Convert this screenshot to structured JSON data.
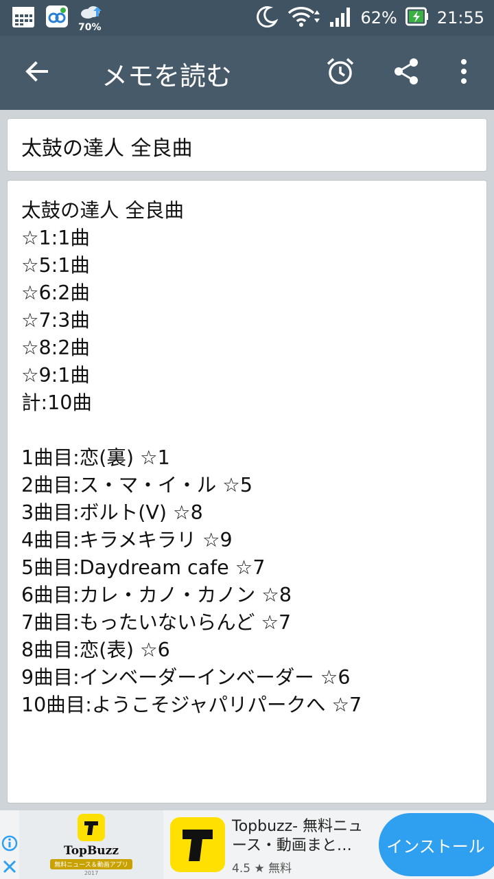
{
  "status_bar": {
    "weather_percent": "70%",
    "battery_percent": "62%",
    "time": "21:55"
  },
  "app_bar": {
    "title": "メモを読む"
  },
  "memo": {
    "title": "太鼓の達人 全良曲",
    "lines": [
      "太鼓の達人 全良曲",
      "☆1:1曲",
      "☆5:1曲",
      "☆6:2曲",
      "☆7:3曲",
      "☆8:2曲",
      "☆9:1曲",
      "計:10曲",
      "",
      "1曲目:恋(裏) ☆1",
      "2曲目:ス・マ・イ・ル ☆5",
      "3曲目:ボルト(V) ☆8",
      "4曲目:キラメキラリ ☆9",
      "5曲目:Daydream cafe ☆7",
      "6曲目:カレ・カノ・カノン ☆8",
      "7曲目:もったいないらんど ☆7",
      "8曲目:恋(表) ☆6",
      "9曲目:インベーダーインベーダー ☆6",
      "10曲目:ようこそジャパリパークへ ☆7"
    ]
  },
  "ad": {
    "thumb_logo": "TopBuzz",
    "thumb_caption": "無料ニュース＆動画アプリ",
    "thumb_year": "2017",
    "app_name": "Topbuzz- 無料ニュース・動画まと…",
    "rating": "4.5",
    "price": "無料",
    "install_label": "インストール"
  },
  "colors": {
    "status_bar": "#3f5363",
    "app_bar": "#475a6a",
    "background": "#cfd4d9",
    "install_button": "#2f9ff0",
    "ad_icon": "#ffe000"
  }
}
